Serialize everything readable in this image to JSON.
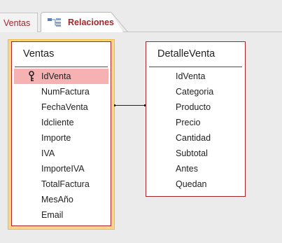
{
  "tabs": [
    {
      "label": "Ventas",
      "icon": "none",
      "active": false
    },
    {
      "label": "Relaciones",
      "icon": "relationships-icon",
      "active": true
    }
  ],
  "tables": {
    "ventas": {
      "title": "Ventas",
      "selected": true,
      "fields": [
        {
          "name": "IdVenta",
          "primary_key": true,
          "selected": true
        },
        {
          "name": "NumFactura"
        },
        {
          "name": "FechaVenta"
        },
        {
          "name": "Idcliente"
        },
        {
          "name": "Importe"
        },
        {
          "name": "IVA"
        },
        {
          "name": "ImporteIVA"
        },
        {
          "name": "TotalFactura"
        },
        {
          "name": "MesAño"
        },
        {
          "name": "Email"
        }
      ]
    },
    "detalle": {
      "title": "DetalleVenta",
      "fields": [
        {
          "name": "IdVenta"
        },
        {
          "name": "Categoria"
        },
        {
          "name": "Producto"
        },
        {
          "name": "Precio"
        },
        {
          "name": "Cantidad"
        },
        {
          "name": "Subtotal"
        },
        {
          "name": "Antes"
        },
        {
          "name": "Quedan"
        }
      ]
    }
  },
  "relationship": {
    "from": "Ventas.IdVenta",
    "to": "DetalleVenta.IdVenta"
  },
  "colors": {
    "accent": "#a4262c",
    "selection_highlight": "#f6b2b2",
    "table_selection_border": "#f4b942"
  }
}
